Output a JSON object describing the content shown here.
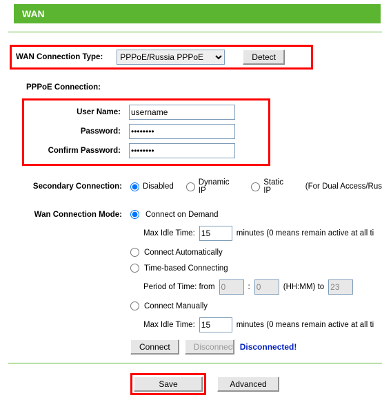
{
  "header": {
    "title": "WAN"
  },
  "conn_type": {
    "label": "WAN Connection Type:",
    "value": "PPPoE/Russia PPPoE",
    "detect_label": "Detect"
  },
  "pppoe": {
    "section": "PPPoE Connection:",
    "username_label": "User Name:",
    "username_value": "username",
    "password_label": "Password:",
    "password_value": "password",
    "confirm_label": "Confirm Password:",
    "confirm_value": "password"
  },
  "secondary": {
    "label": "Secondary Connection:",
    "disabled": "Disabled",
    "dynamic": "Dynamic IP",
    "static": "Static IP",
    "note": "(For Dual Access/Rus"
  },
  "mode": {
    "label": "Wan Connection Mode:",
    "on_demand": "Connect on Demand",
    "max_idle_label": "Max Idle Time:",
    "max_idle_value1": "15",
    "max_idle_suffix": "minutes (0 means remain active at all ti",
    "auto": "Connect Automatically",
    "time_based": "Time-based Connecting",
    "period_label": "Period of Time: from",
    "period_from": "0",
    "period_sep": ":",
    "period_to": "0",
    "hhmm": "(HH:MM) to",
    "period_end": "23",
    "manual": "Connect Manually",
    "max_idle_value2": "15"
  },
  "actions": {
    "connect": "Connect",
    "disconnect": "Disconnect",
    "status": "Disconnected!"
  },
  "footer": {
    "save": "Save",
    "advanced": "Advanced"
  }
}
